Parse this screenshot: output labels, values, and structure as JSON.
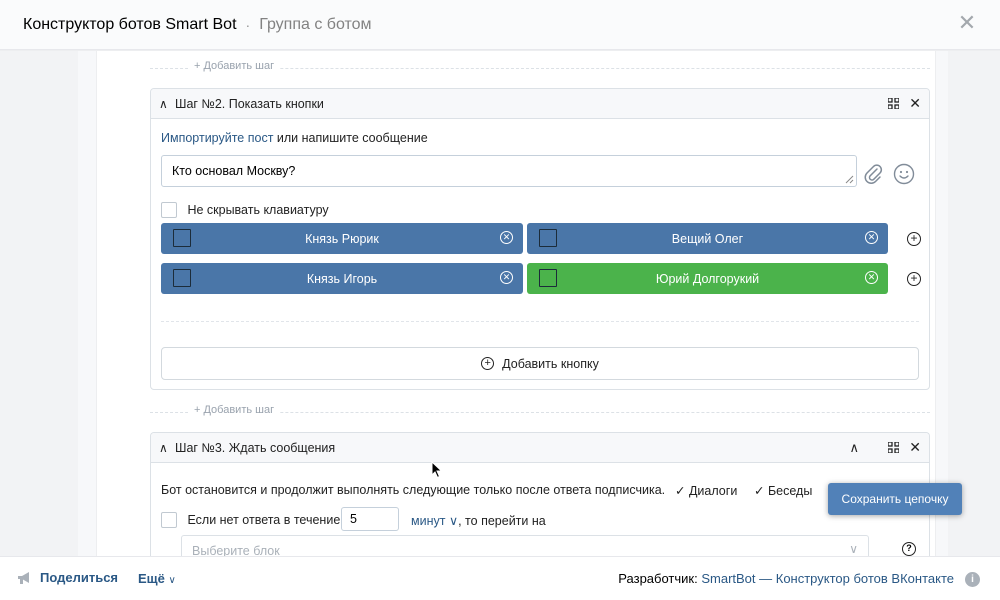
{
  "header": {
    "app_title": "Конструктор ботов Smart Bot",
    "separator": "·",
    "subtitle": "Группа с ботом",
    "close_glyph": "✕"
  },
  "add_step_label": "+ Добавить шаг",
  "step2": {
    "title": "Шаг №2. Показать кнопки",
    "import_link": "Импортируйте пост",
    "import_rest": " или напишите сообщение",
    "message": "Кто основал Москву?",
    "no_hide_keyboard": "Не скрывать клавиатуру",
    "buttons": [
      {
        "label": "Князь Рюрик",
        "color": "#4a76a8"
      },
      {
        "label": "Вещий Олег",
        "color": "#4a76a8"
      },
      {
        "label": "Князь Игорь",
        "color": "#4a76a8"
      },
      {
        "label": "Юрий Долгорукий",
        "color": "#4bb34b"
      }
    ],
    "add_button_label": "Добавить кнопку"
  },
  "step3": {
    "title": "Шаг №3. Ждать сообщения",
    "description": "Бот остановится и продолжит выполнять следующие только после ответа подписчика.",
    "opt_dialogs": "Диалоги",
    "opt_chats": "Беседы",
    "no_answer_label": "Если нет ответа в течение",
    "timeout_value": "5",
    "timeout_unit": "минут",
    "goto_label": ", то перейти на",
    "block_placeholder": "Выберите блок"
  },
  "save_chain_label": "Сохранить цепочку",
  "footer": {
    "share": "Поделиться",
    "more": "Ещё",
    "dev_prefix": "Разработчик: ",
    "dev_link": "SmartBot — Конструктор ботов ВКонтакте"
  },
  "colors": {
    "accent": "#4a76a8",
    "green": "#4bb34b",
    "link": "#2a5885"
  }
}
